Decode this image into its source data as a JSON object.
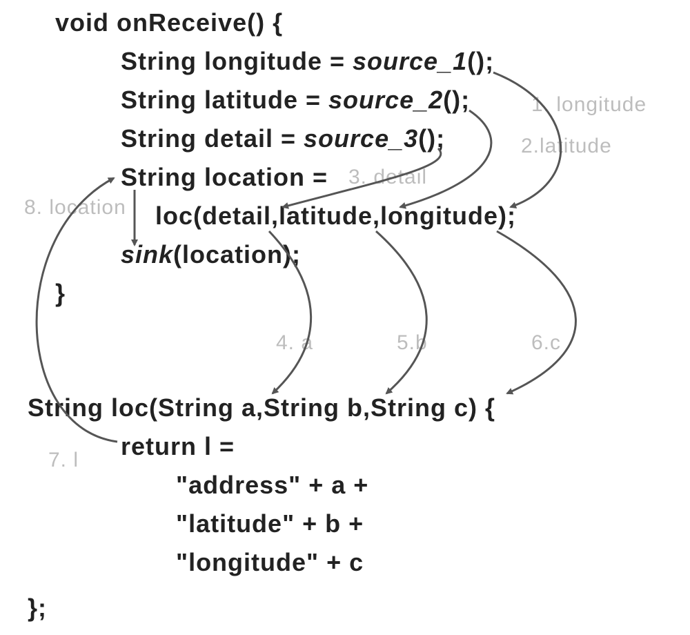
{
  "code": {
    "line1": "void onReceive() {",
    "line2a": "String longitude = ",
    "line2b": "source_1",
    "line2c": "();",
    "line3a": "String latitude = ",
    "line3b": "source_2",
    "line3c": "();",
    "line4a": "String detail = ",
    "line4b": "source_3",
    "line4c": "();",
    "line5": "String location =",
    "line6": "loc(detail,latitude,longitude);",
    "line7a": "sink",
    "line7b": "(location);",
    "line8": "}",
    "line9": "String loc(String a,String b,String c) {",
    "line10": "return l =",
    "line11": "\"address\"   + a +",
    "line12": "\"latitude\"   + b +",
    "line13": "\"longitude\"  + c",
    "line14": "};"
  },
  "annotations": {
    "a1": "1. longitude",
    "a2": "2.latitude",
    "a3": "3. detail",
    "a4": "4. a",
    "a5": "5.b",
    "a6": "6.c",
    "a7": "7. l",
    "a8": "8. location"
  },
  "chart_data": {
    "type": "diagram",
    "description": "Data-flow taint-tracking diagram over Java-like pseudocode. Three sources source_1/2/3 assign longitude, latitude, detail. These are passed as arguments to loc(detail, latitude, longitude), bound to parameters a, b, c. loc concatenates them into l which is returned to location, then passed to sink(location).",
    "nodes": [
      {
        "id": 1,
        "name": "longitude",
        "kind": "variable",
        "origin": "source_1"
      },
      {
        "id": 2,
        "name": "latitude",
        "kind": "variable",
        "origin": "source_2"
      },
      {
        "id": 3,
        "name": "detail",
        "kind": "variable",
        "origin": "source_3"
      },
      {
        "id": 4,
        "name": "a",
        "kind": "parameter",
        "bound_from": "detail"
      },
      {
        "id": 5,
        "name": "b",
        "kind": "parameter",
        "bound_from": "latitude"
      },
      {
        "id": 6,
        "name": "c",
        "kind": "parameter",
        "bound_from": "longitude"
      },
      {
        "id": 7,
        "name": "l",
        "kind": "local",
        "computed_from": [
          "a",
          "b",
          "c",
          "\"address\"",
          "\"latitude\"",
          "\"longitude\""
        ]
      },
      {
        "id": 8,
        "name": "location",
        "kind": "variable",
        "assigned_from": "loc(...) return l"
      }
    ],
    "edges": [
      {
        "from": "source_1()",
        "to": "longitude"
      },
      {
        "from": "source_2()",
        "to": "latitude"
      },
      {
        "from": "source_3()",
        "to": "detail"
      },
      {
        "from": "longitude",
        "to": "longitude-arg"
      },
      {
        "from": "latitude",
        "to": "latitude-arg"
      },
      {
        "from": "detail",
        "to": "detail-arg"
      },
      {
        "from": "detail-arg",
        "to": "a"
      },
      {
        "from": "latitude-arg",
        "to": "b"
      },
      {
        "from": "longitude-arg",
        "to": "c"
      },
      {
        "from": "l",
        "to": "location"
      },
      {
        "from": "location-decl",
        "to": "location-use-in-sink"
      },
      {
        "from": "location",
        "to": "sink"
      }
    ]
  }
}
